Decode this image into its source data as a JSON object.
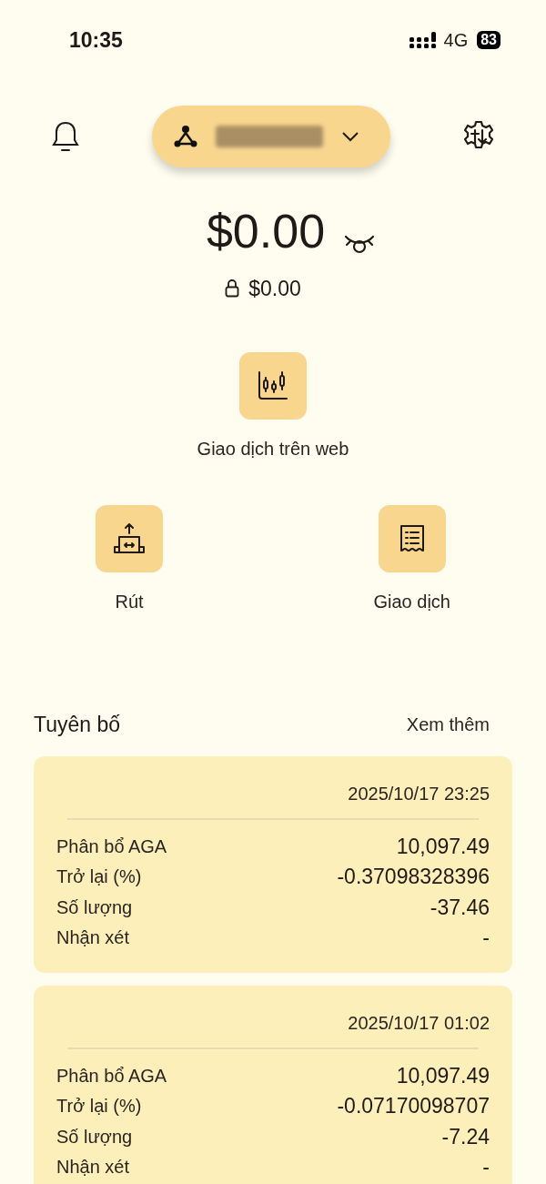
{
  "status_bar": {
    "time": "10:35",
    "network": "4G",
    "battery": "83"
  },
  "balance": {
    "total": "$0.00",
    "locked": "$0.00"
  },
  "featured_action": {
    "label": "Giao dịch trên web"
  },
  "actions": [
    {
      "label": "Rút"
    },
    {
      "label": "Giao dịch"
    }
  ],
  "statements": {
    "title": "Tuyên bố",
    "more": "Xem thêm",
    "entries": [
      {
        "time": "2025/10/17 23:25",
        "rows": [
          {
            "label": "Phân bổ AGA",
            "value": "10,097.49"
          },
          {
            "label": "Trở lại (%)",
            "value": "-0.37098328396"
          },
          {
            "label": "Số lượng",
            "value": "-37.46"
          },
          {
            "label": "Nhận xét",
            "value": "-"
          }
        ]
      },
      {
        "time": "2025/10/17 01:02",
        "rows": [
          {
            "label": "Phân bổ AGA",
            "value": "10,097.49"
          },
          {
            "label": "Trở lại (%)",
            "value": "-0.07170098707"
          },
          {
            "label": "Số lượng",
            "value": "-7.24"
          },
          {
            "label": "Nhận xét",
            "value": "-"
          }
        ]
      }
    ]
  }
}
